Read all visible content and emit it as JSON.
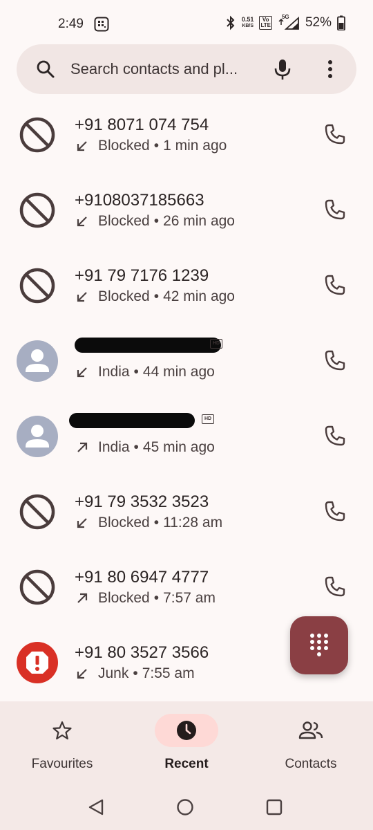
{
  "status_bar": {
    "time": "2:49",
    "speed_value": "0.51",
    "speed_unit": "KB/S",
    "volte_top": "Vo",
    "volte_bottom": "LTE",
    "network": "5G",
    "battery": "52%"
  },
  "search": {
    "placeholder": "Search contacts and pl..."
  },
  "calls": [
    {
      "name": "+91 8071 074 754",
      "direction": "incoming",
      "label": "Blocked",
      "time": "1 min ago",
      "avatar": "blocked-icon"
    },
    {
      "name": "+9108037185663",
      "direction": "incoming",
      "label": "Blocked",
      "time": "26 min ago",
      "avatar": "blocked-icon"
    },
    {
      "name": "+91 79 7176 1239",
      "direction": "incoming",
      "label": "Blocked",
      "time": "42 min ago",
      "avatar": "blocked-icon"
    },
    {
      "name": "",
      "direction": "incoming",
      "label": "India",
      "time": "44 min ago",
      "avatar": "person-icon"
    },
    {
      "name": "",
      "direction": "outgoing",
      "label": "India",
      "time": "45 min ago",
      "avatar": "person-icon"
    },
    {
      "name": "+91 79 3532 3523",
      "direction": "incoming",
      "label": "Blocked",
      "time": "11:28 am",
      "avatar": "blocked-icon"
    },
    {
      "name": "+91 80 6947 4777",
      "direction": "outgoing",
      "label": "Blocked",
      "time": "7:57 am",
      "avatar": "blocked-icon"
    },
    {
      "name": "+91 80 3527 3566",
      "direction": "incoming",
      "label": "Junk",
      "time": "7:55 am",
      "avatar": "spam-icon"
    }
  ],
  "separator": "•",
  "hd_badge": "HD",
  "nav": {
    "favourites": "Favourites",
    "recent": "Recent",
    "contacts": "Contacts",
    "active": "recent"
  },
  "colors": {
    "background": "#fdf8f7",
    "fab": "#8a3f44",
    "spam": "#d93025",
    "avatar_placeholder": "#a7aec2",
    "active_pill": "#fed9d6"
  }
}
